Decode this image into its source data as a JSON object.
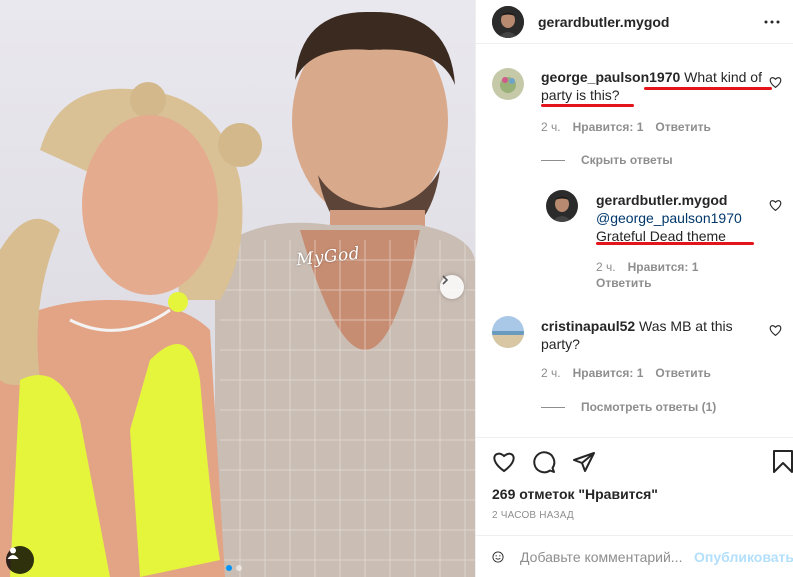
{
  "post": {
    "watermark": "MyGod"
  },
  "header": {
    "username": "gerardbutler.mygod"
  },
  "comments": [
    {
      "username": "george_paulson1970",
      "text": "What kind of party is this?",
      "age": "2 ч.",
      "likes": "Нравится: 1",
      "reply": "Ответить",
      "replies_toggle": "Скрыть ответы"
    },
    {
      "username": "cristinapaul52",
      "text": "Was MB at this party?",
      "age": "2 ч.",
      "likes": "Нравится: 1",
      "reply": "Ответить",
      "replies_toggle": "Посмотреть ответы (1)"
    }
  ],
  "reply": {
    "username": "gerardbutler.mygod",
    "mention": "@george_paulson1970",
    "text": "Grateful Dead theme",
    "age": "2 ч.",
    "likes": "Нравится: 1",
    "reply": "Ответить"
  },
  "footer": {
    "likes": "269 отметок \"Нравится\"",
    "time": "2 часов назад",
    "comment_placeholder": "Добавьте комментарий...",
    "post_label": "Опубликовать"
  },
  "colors": {
    "link": "#00376b",
    "accent": "#0095f6",
    "annotation": "#e4141b"
  }
}
